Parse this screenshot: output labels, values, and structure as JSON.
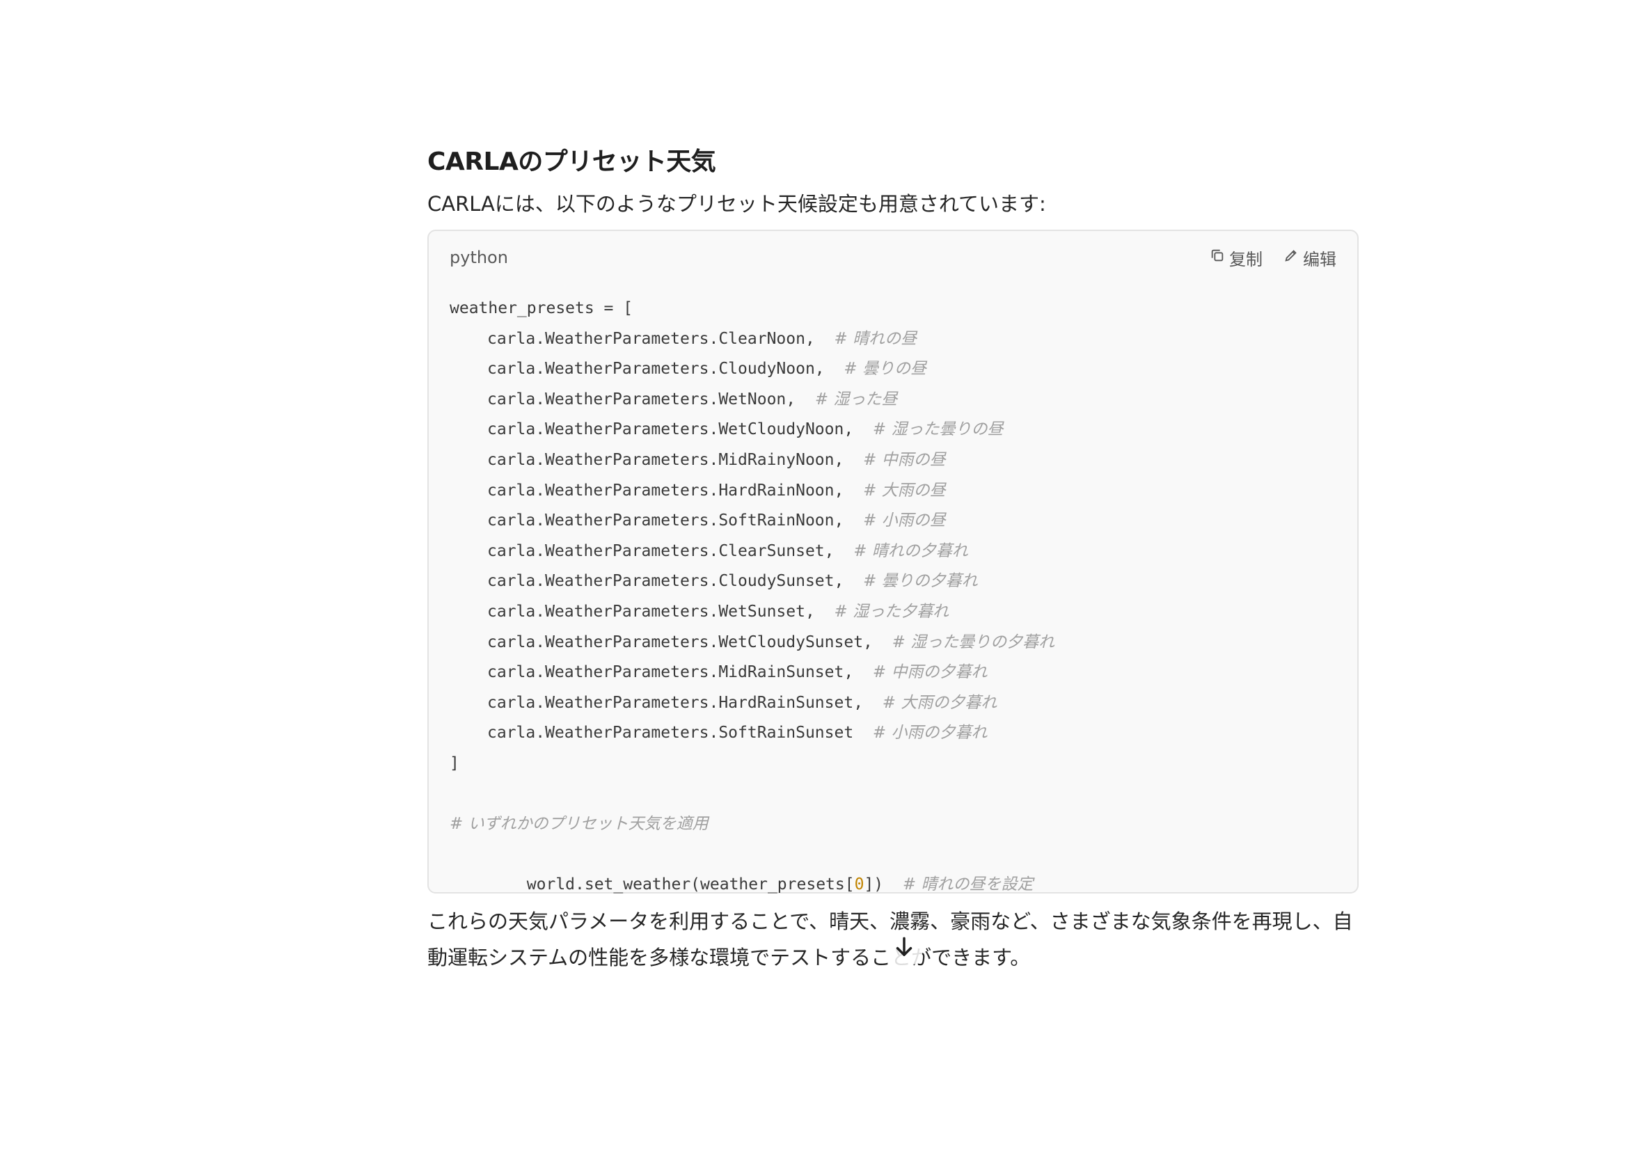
{
  "heading": "CARLAのプリセット天気",
  "intro": "CARLAには、以下のようなプリセット天候設定も用意されています:",
  "code_block": {
    "language": "python",
    "copy_label": "复制",
    "edit_label": "编辑",
    "lines": [
      {
        "indent": 0,
        "code": "weather_presets = [",
        "comment": ""
      },
      {
        "indent": 1,
        "code": "carla.WeatherParameters.ClearNoon,",
        "comment": "# 晴れの昼"
      },
      {
        "indent": 1,
        "code": "carla.WeatherParameters.CloudyNoon,",
        "comment": "# 曇りの昼"
      },
      {
        "indent": 1,
        "code": "carla.WeatherParameters.WetNoon,",
        "comment": "# 湿った昼"
      },
      {
        "indent": 1,
        "code": "carla.WeatherParameters.WetCloudyNoon,",
        "comment": "# 湿った曇りの昼"
      },
      {
        "indent": 1,
        "code": "carla.WeatherParameters.MidRainyNoon,",
        "comment": "# 中雨の昼"
      },
      {
        "indent": 1,
        "code": "carla.WeatherParameters.HardRainNoon,",
        "comment": "# 大雨の昼"
      },
      {
        "indent": 1,
        "code": "carla.WeatherParameters.SoftRainNoon,",
        "comment": "# 小雨の昼"
      },
      {
        "indent": 1,
        "code": "carla.WeatherParameters.ClearSunset,",
        "comment": "# 晴れの夕暮れ"
      },
      {
        "indent": 1,
        "code": "carla.WeatherParameters.CloudySunset,",
        "comment": "# 曇りの夕暮れ"
      },
      {
        "indent": 1,
        "code": "carla.WeatherParameters.WetSunset,",
        "comment": "# 湿った夕暮れ"
      },
      {
        "indent": 1,
        "code": "carla.WeatherParameters.WetCloudySunset,",
        "comment": "# 湿った曇りの夕暮れ"
      },
      {
        "indent": 1,
        "code": "carla.WeatherParameters.MidRainSunset,",
        "comment": "# 中雨の夕暮れ"
      },
      {
        "indent": 1,
        "code": "carla.WeatherParameters.HardRainSunset,",
        "comment": "# 大雨の夕暮れ"
      },
      {
        "indent": 1,
        "code": "carla.WeatherParameters.SoftRainSunset",
        "comment": "# 小雨の夕暮れ"
      },
      {
        "indent": 0,
        "code": "]",
        "comment": ""
      },
      {
        "indent": 0,
        "code": "",
        "comment": ""
      },
      {
        "indent": 0,
        "code": "",
        "comment": "# いずれかのプリセット天気を適用"
      }
    ],
    "last_line": {
      "before": "world.set_weather(weather_presets[",
      "number": "0",
      "after": "])",
      "comment": "# 晴れの昼を設定"
    }
  },
  "closing": "これらの天気パラメータを利用することで、晴天、濃霧、豪雨など、さまざまな気象条件を再現し、自動運転システムの性能を多様な環境でテストすることができます。",
  "icons": {
    "copy": "copy-icon",
    "edit": "edit-icon",
    "scroll_down": "arrow-down-icon"
  }
}
